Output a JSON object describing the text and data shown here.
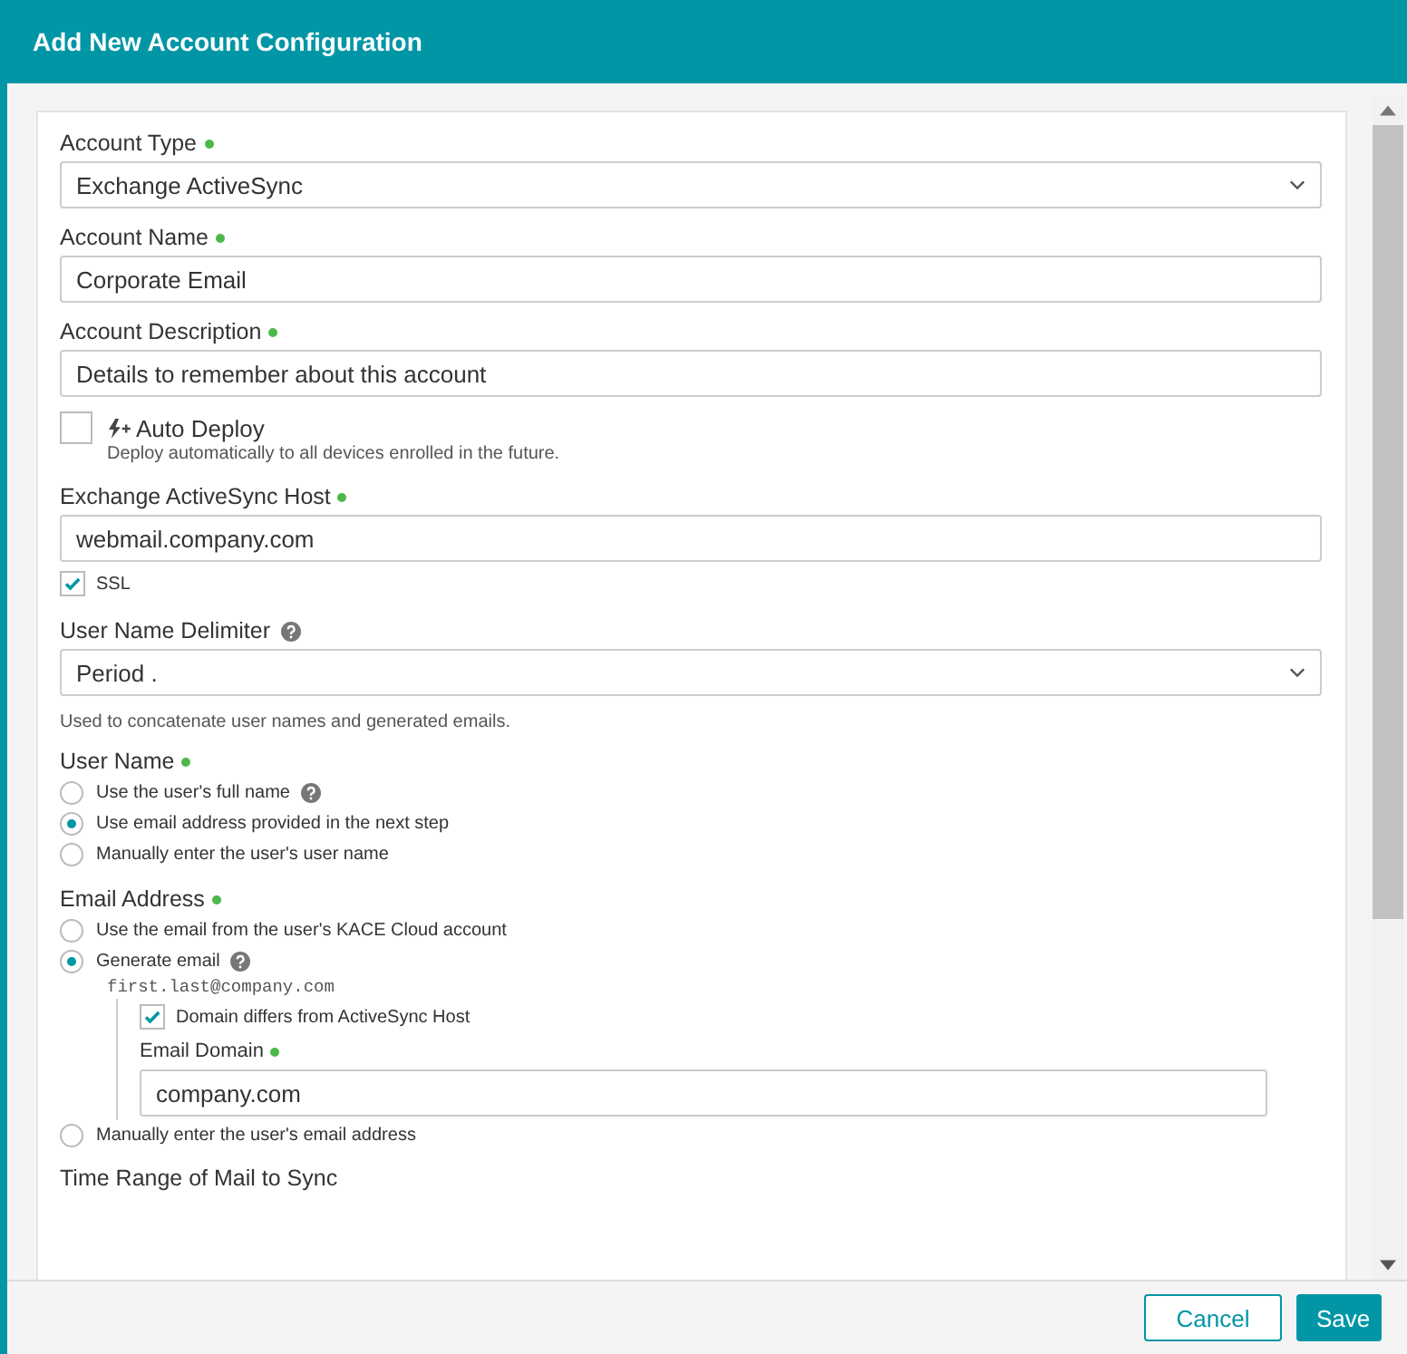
{
  "dialog": {
    "title": "Add New Account Configuration"
  },
  "form": [
    {
      "kind": "select",
      "label": "Account Type",
      "required": true,
      "value": "Exchange ActiveSync"
    },
    {
      "kind": "text",
      "label": "Account Name",
      "required": true,
      "value": "Corporate Email"
    },
    {
      "kind": "text",
      "label": "Account Description",
      "required": true,
      "value": "Details to remember about this account"
    },
    {
      "kind": "feature_checkbox",
      "label": "Auto Deploy",
      "checked": false,
      "description": "Deploy automatically to all devices enrolled in the future."
    },
    {
      "kind": "text",
      "label": "Exchange ActiveSync Host",
      "required": true,
      "value": "webmail.company.com"
    },
    {
      "kind": "checkbox",
      "label": "SSL",
      "checked": true
    },
    {
      "kind": "select",
      "label": "User Name Delimiter",
      "help": true,
      "value": "Period .",
      "hint": "Used to concatenate user names and generated emails."
    },
    {
      "kind": "radio_group",
      "label": "User Name",
      "required": true,
      "options": [
        {
          "label": "Use the user's full name",
          "selected": false,
          "help": true
        },
        {
          "label": "Use email address provided in the next step",
          "selected": true
        },
        {
          "label": "Manually enter the user's user name",
          "selected": false
        }
      ]
    },
    {
      "kind": "radio_group",
      "label": "Email Address",
      "required": true,
      "options": [
        {
          "label": "Use the email from the user's KACE Cloud account",
          "selected": false
        },
        {
          "label": "Generate email",
          "selected": true,
          "help": true,
          "example": "first.last@company.com",
          "children": [
            {
              "kind": "checkbox",
              "label": "Domain differs from ActiveSync Host",
              "checked": true
            },
            {
              "kind": "text",
              "label": "Email Domain",
              "required": true,
              "value": "company.com"
            }
          ]
        },
        {
          "label": "Manually enter the user's email address",
          "selected": false
        }
      ]
    },
    {
      "kind": "heading",
      "label": "Time Range of Mail to Sync"
    }
  ],
  "buttons": [
    {
      "label": "Cancel",
      "kind": "secondary"
    },
    {
      "label": "Save",
      "kind": "primary"
    }
  ]
}
